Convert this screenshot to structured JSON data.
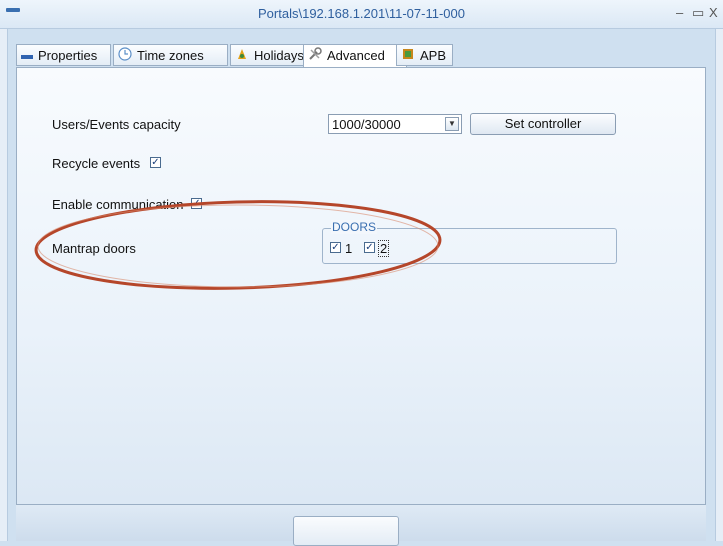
{
  "window": {
    "title": "Portals\\192.168.1.201\\11-07-11-000",
    "minimize_glyph": "–",
    "maximize_glyph": "▭",
    "close_glyph": "X"
  },
  "tabs": [
    {
      "label": "Properties",
      "icon": "properties-icon"
    },
    {
      "label": "Time zones",
      "icon": "clock-icon"
    },
    {
      "label": "Holidays",
      "icon": "holidays-icon"
    },
    {
      "label": "Advanced",
      "icon": "tools-icon",
      "active": true
    },
    {
      "label": "APB",
      "icon": "apb-icon"
    }
  ],
  "form": {
    "capacity_label": "Users/Events capacity",
    "capacity_value": "1000/30000",
    "set_controller_label": "Set controller",
    "recycle_label": "Recycle events",
    "recycle_checked": true,
    "communication_label": "Enable communication",
    "communication_checked": true,
    "mantrap_label": "Mantrap doors",
    "doors_group_label": "DOORS",
    "doors": [
      {
        "label": "1",
        "checked": true
      },
      {
        "label": "2",
        "checked": true
      }
    ]
  },
  "colors": {
    "accent": "#3a6fb0",
    "annotation": "#b5462a"
  }
}
